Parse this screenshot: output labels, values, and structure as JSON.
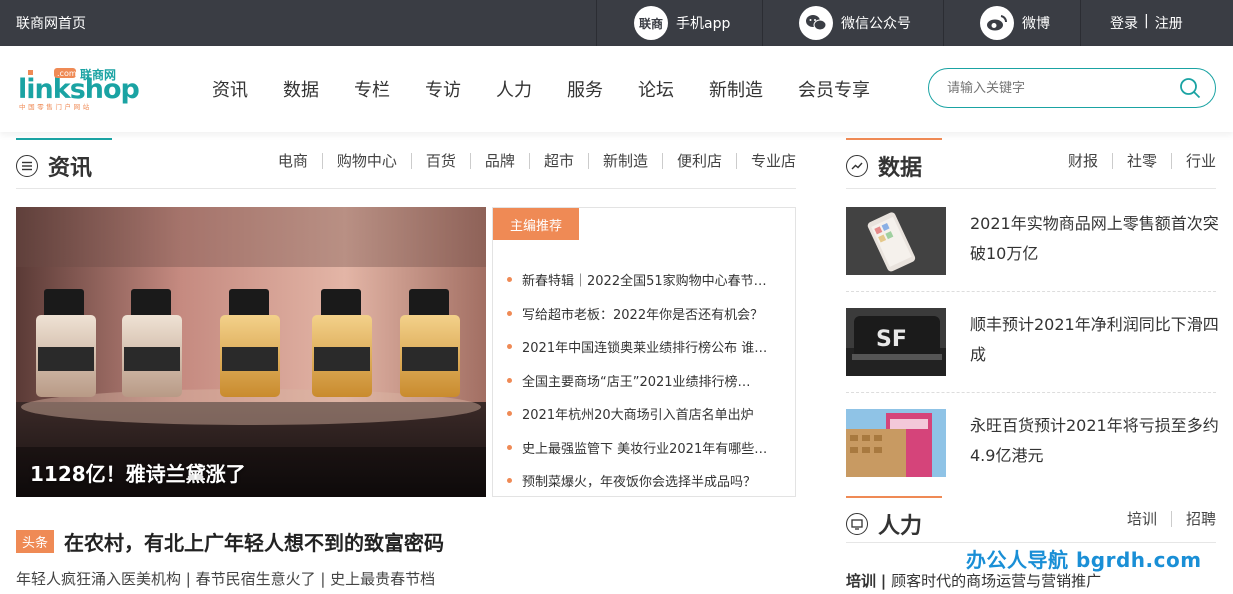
{
  "topbar": {
    "home": "联商网首页",
    "app_icon": "联商",
    "app": "手机app",
    "wechat": "微信公众号",
    "weibo": "微博",
    "login": "登录",
    "divider": "|",
    "register": "注册"
  },
  "logo": {
    "text": "linkshop",
    "cn": "联商网",
    "com": ".com",
    "tagline": "中国零售门户网站"
  },
  "nav": [
    "资讯",
    "数据",
    "专栏",
    "专访",
    "人力",
    "服务",
    "论坛",
    "新制造",
    "会员专享"
  ],
  "search": {
    "placeholder": "请输入关键字"
  },
  "news_section": {
    "title": "资讯",
    "links": [
      "电商",
      "购物中心",
      "百货",
      "品牌",
      "超市",
      "新制造",
      "便利店",
      "专业店"
    ],
    "hero_caption": "1128亿！雅诗兰黛涨了",
    "picks_tag": "主编推荐",
    "picks": [
      "新春特辑｜2022全国51家购物中心春节…",
      "写给超市老板：2022年你是否还有机会？",
      "2021年中国连锁奥莱业绩排行榜公布 谁…",
      "全国主要商场“店王”2021业绩排行榜…",
      "2021年杭州20大商场引入首店名单出炉",
      "史上最强监管下 美妆行业2021年有哪些…",
      "预制菜爆火，年夜饭你会选择半成品吗？"
    ],
    "headline_badge": "头条",
    "headline": "在农村，有北上广年轻人想不到的致富密码",
    "subline": "年轻人疯狂涌入医美机构 | 春节民宿生意火了 | 史上最贵春节档"
  },
  "data_section": {
    "title": "数据",
    "links": [
      "财报",
      "社零",
      "行业"
    ],
    "items": [
      {
        "title": "2021年实物商品网上零售额首次突破10万亿"
      },
      {
        "title": "顺丰预计2021年净利润同比下滑四成"
      },
      {
        "title": "永旺百货预计2021年将亏损至多约4.9亿港元"
      }
    ]
  },
  "hr_section": {
    "title": "人力",
    "links": [
      "培训",
      "招聘"
    ],
    "item_tag": "培训",
    "item_divider": "|",
    "item_text": "顾客时代的商场运营与营销推广"
  },
  "watermark": "办公人导航  bgrdh.com",
  "colors": {
    "teal": "#1aa3a3",
    "orange": "#ef8a55",
    "topbar": "#3a3d44"
  }
}
